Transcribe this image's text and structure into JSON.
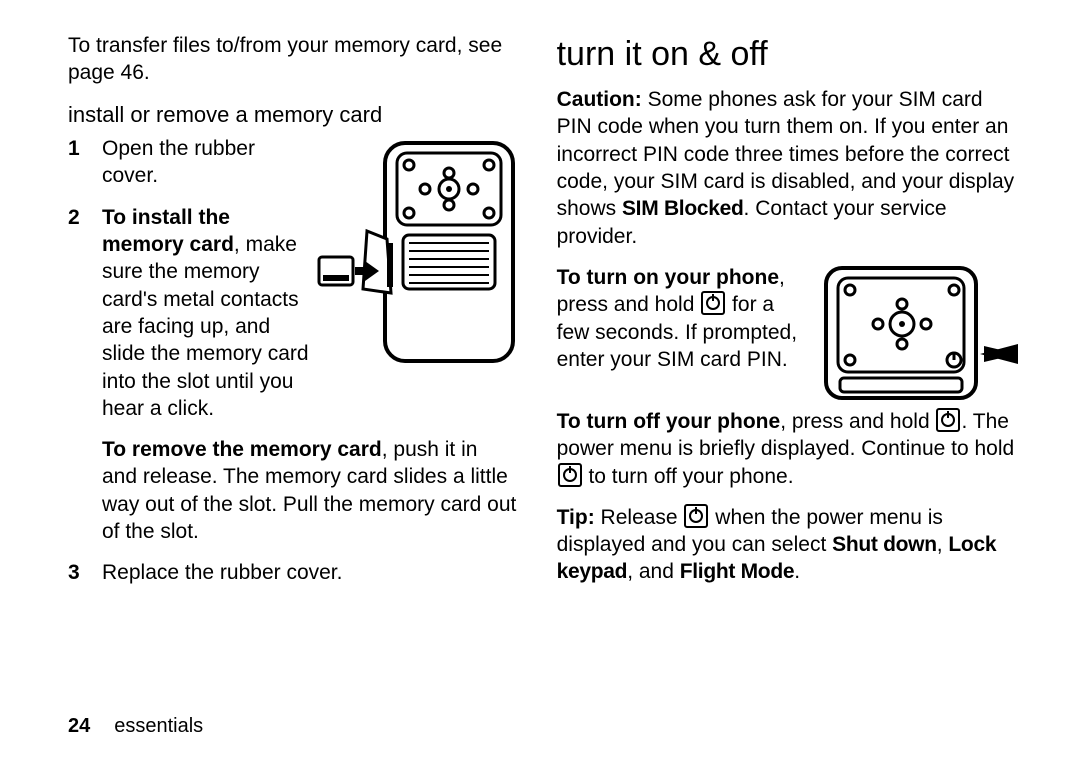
{
  "left": {
    "intro": "To transfer files to/from your memory card, see page 46.",
    "subhead": "install or remove a memory card",
    "step1": "Open the rubber cover.",
    "step2_bold": "To install the memory card",
    "step2_rest_a": ", make sure the memory card's metal contacts",
    "step2_rest_b": "are facing up, and slide the memory card into the slot until you hear a click.",
    "step2_remove_bold": "To remove the memory card",
    "step2_remove_rest": ", push it in and release. The memory card slides a little way out of the slot. Pull the memory card out of the slot.",
    "step3": "Replace the rubber cover."
  },
  "right": {
    "heading": "turn it on & off",
    "caution_lead": "Caution:",
    "caution_body_a": " Some phones ask for your SIM card PIN code when you turn them on. If you enter an incorrect PIN code three times before the correct code, your SIM card is disabled, and your display shows ",
    "caution_sim_blocked": "SIM Blocked",
    "caution_body_b": ". Contact your service provider.",
    "turn_on_bold": "To turn on your phone",
    "turn_on_a": ", press and hold ",
    "turn_on_b": " for a few seconds. If prompted, enter your SIM card PIN.",
    "turn_off_bold": "To turn off your phone",
    "turn_off_a": ", press and hold ",
    "turn_off_b": ". The power menu is briefly displayed. Continue to hold ",
    "turn_off_c": " to turn off your phone.",
    "tip_lead": "Tip:",
    "tip_a": " Release ",
    "tip_b": " when the power menu is displayed and you can select ",
    "opt_shutdown": "Shut down",
    "tip_c": ", ",
    "opt_lock": "Lock keypad",
    "tip_d": ", and ",
    "opt_flight": "Flight Mode",
    "tip_e": "."
  },
  "footer": {
    "page": "24",
    "section": "essentials"
  }
}
